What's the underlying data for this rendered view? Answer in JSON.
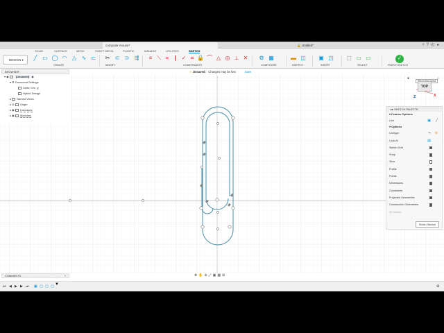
{
  "title_bar": {
    "active_tab": "computer mouse*",
    "untitled_tab": "Untitled*"
  },
  "workspace_tabs": [
    "SOLID",
    "SURFACE",
    "MESH",
    "SHEET METAL",
    "PLASTIC",
    "MANAGE",
    "UTILITIES",
    "SKETCH"
  ],
  "toolbar": {
    "design_label": "DESIGN",
    "groups": [
      "CREATE",
      "MODIFY",
      "CONSTRAINTS",
      "CONFIGURE",
      "INSPECT",
      "INSERT",
      "SELECT",
      "FINISH SKETCH"
    ]
  },
  "unsaved_bar": {
    "status": "Unsaved:",
    "message": "Changes may be lost",
    "save_label": "Save"
  },
  "browser": {
    "title": "BROWSER",
    "items": [
      {
        "label": "(Unsaved)"
      },
      {
        "label": "Document Settings"
      },
      {
        "label": "Units: mm, g"
      },
      {
        "label": "Hybrid Design"
      },
      {
        "label": "Named Views"
      },
      {
        "label": "Origin"
      },
      {
        "label": "Canvases"
      },
      {
        "label": "Sketches"
      }
    ]
  },
  "comments": {
    "title": "COMMENTS"
  },
  "view_cube": {
    "face": "TOP",
    "axis_x": "X",
    "axis_z": "Z"
  },
  "tooltip": {
    "text": "Place first point"
  },
  "sketch_palette": {
    "title": "SKETCH PALETTE",
    "feature_options_label": "Feature Options",
    "line_label": "Line",
    "options_label": "Options",
    "rows": [
      {
        "label": "Linetype",
        "kind": "icons"
      },
      {
        "label": "Look At",
        "kind": "icon"
      },
      {
        "label": "Sketch Grid",
        "kind": "check",
        "checked": true
      },
      {
        "label": "Snap",
        "kind": "check",
        "checked": true
      },
      {
        "label": "Slice",
        "kind": "check",
        "checked": false
      },
      {
        "label": "Profile",
        "kind": "check",
        "checked": true
      },
      {
        "label": "Points",
        "kind": "check",
        "checked": true
      },
      {
        "label": "Dimensions",
        "kind": "check",
        "checked": true
      },
      {
        "label": "Constraints",
        "kind": "check",
        "checked": true
      },
      {
        "label": "Projected Geometries",
        "kind": "check",
        "checked": true
      },
      {
        "label": "Construction Geometries",
        "kind": "check",
        "checked": true
      },
      {
        "label": "3D Sketch",
        "kind": "check-dim",
        "checked": false
      }
    ],
    "finish_label": "Finish Sketch"
  },
  "colors": {
    "accent": "#0696d7",
    "sketch_line": "#4a8fa8",
    "grid_minor": "#eeeeee",
    "grid_major": "#dddddd",
    "finish_green": "#2fb344"
  }
}
